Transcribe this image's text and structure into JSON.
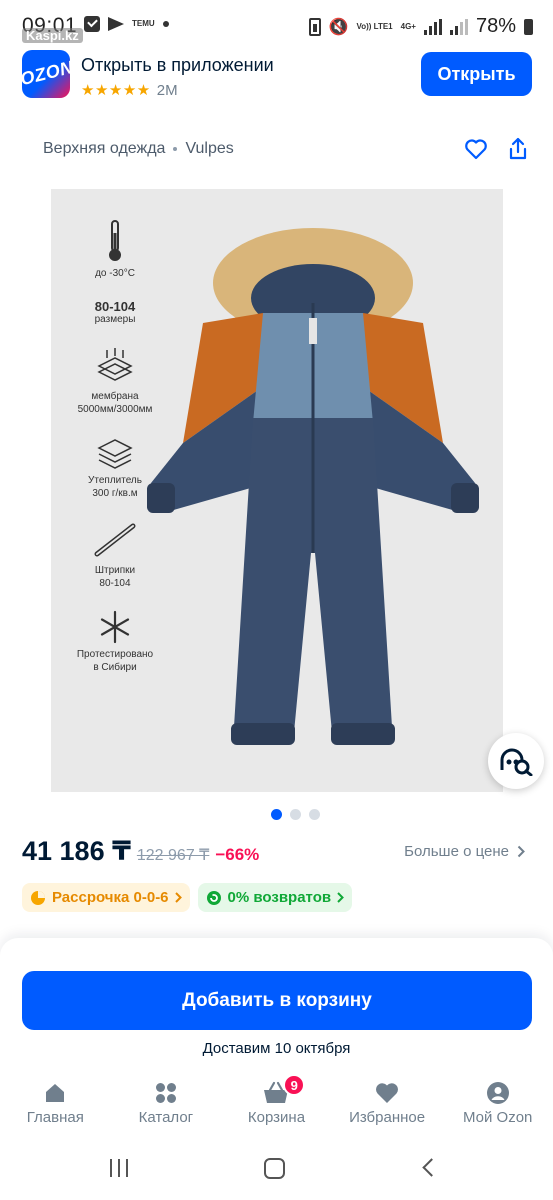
{
  "status_bar": {
    "time": "09:01",
    "url_hint": "Kaspi.kz",
    "temu_label": "TEMU",
    "battery": "78%",
    "net_label": "Vo)) LTE1",
    "net_gen": "4G+"
  },
  "app_banner": {
    "title": "Открыть в приложении",
    "stars": "★★★★★",
    "downloads": "2M",
    "open_label": "Открыть",
    "logo_text": "OZON"
  },
  "breadcrumb": {
    "category": "Верхняя одежда",
    "brand": "Vulpes"
  },
  "features": {
    "temp": "до -30°C",
    "sizes_title": "80-104",
    "sizes_label": "размеры",
    "membrane_label": "мембрана",
    "membrane_value": "5000мм/3000мм",
    "insulation_label": "Утеплитель",
    "insulation_value": "300 г/кв.м",
    "straps_label": "Штрипки",
    "straps_value": "80-104",
    "tested_label": "Протестировано",
    "tested_value": "в Сибири"
  },
  "gallery": {
    "slides": 3,
    "active_index": 0
  },
  "pricing": {
    "price": "41 186 ₸",
    "old_price": "122 967 ₸",
    "discount": "−66%",
    "more_price": "Больше о цене"
  },
  "badges": {
    "installment": "Рассрочка 0-0-6",
    "returns": "0% возвратов"
  },
  "cart": {
    "add_label": "Добавить в корзину",
    "delivery": "Доставим 10 октября"
  },
  "tabbar": {
    "home": "Главная",
    "catalog": "Каталог",
    "cart": "Корзина",
    "cart_count": "9",
    "favorites": "Избранное",
    "profile": "Мой Ozon"
  },
  "colors": {
    "accent": "#005bff",
    "discount": "#f91155",
    "installment": "#e68a00",
    "returns": "#10a837"
  }
}
